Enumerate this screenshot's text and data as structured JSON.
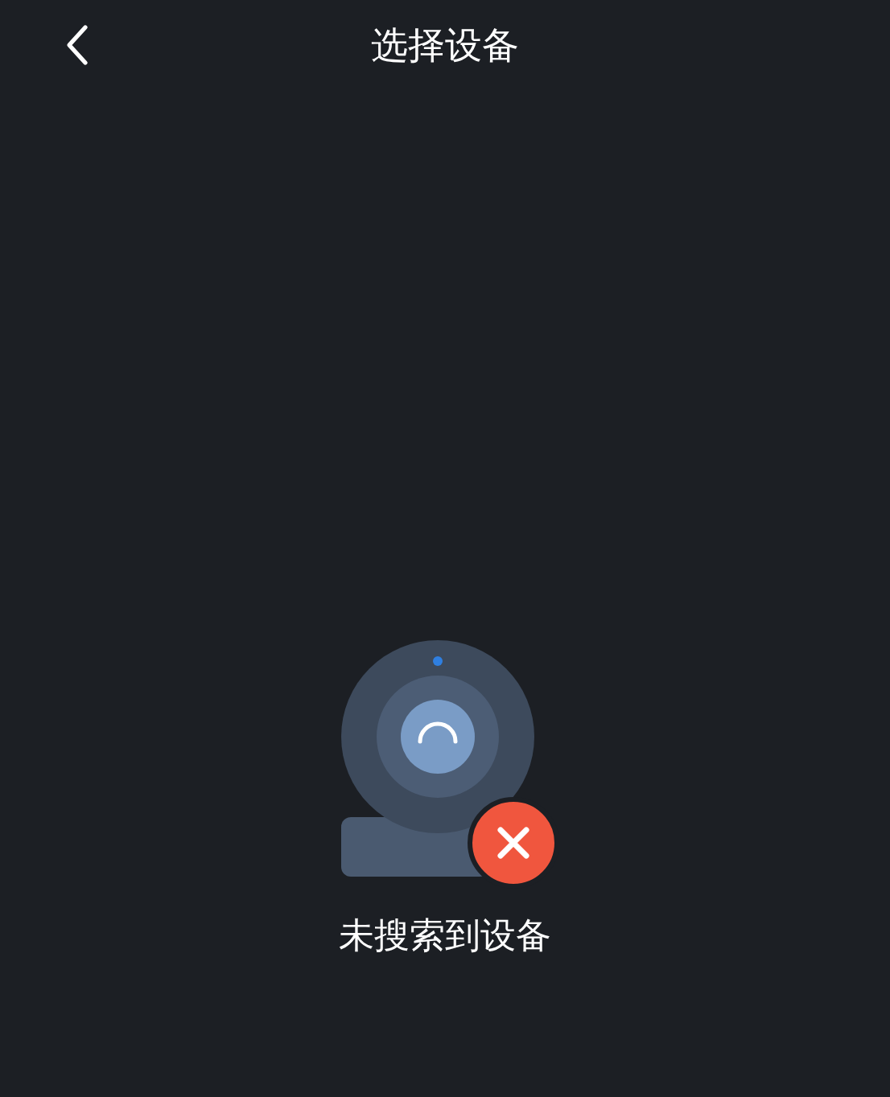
{
  "header": {
    "title": "选择设备"
  },
  "empty_state": {
    "message": "未搜索到设备"
  }
}
